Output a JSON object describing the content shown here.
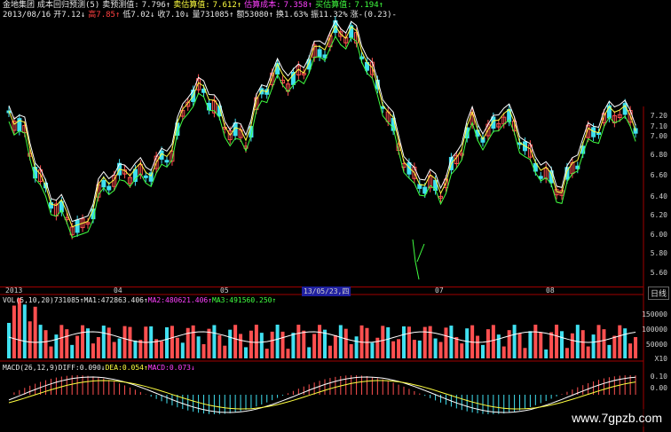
{
  "header": {
    "line1": [
      {
        "text": "金地集团",
        "color": "c-w"
      },
      {
        "text": "成本回归预测(5)",
        "color": "c-w"
      },
      {
        "text": "卖预测值:",
        "color": "c-w"
      },
      {
        "text": "7.796↑",
        "color": "c-w"
      },
      {
        "text": "卖估算值:",
        "color": "c-y"
      },
      {
        "text": "7.612↑",
        "color": "c-y"
      },
      {
        "text": "估算成本:",
        "color": "c-m"
      },
      {
        "text": "7.358↑",
        "color": "c-m"
      },
      {
        "text": "买估算值:",
        "color": "c-g"
      },
      {
        "text": "7.194↑",
        "color": "c-g"
      }
    ],
    "line2": [
      {
        "text": "2013/08/16",
        "color": "c-w"
      },
      {
        "text": "开7.12↓",
        "color": "c-w"
      },
      {
        "text": "高7.85↑",
        "color": "c-r"
      },
      {
        "text": "低7.02↓",
        "color": "c-w"
      },
      {
        "text": "收7.10↓",
        "color": "c-w"
      },
      {
        "text": "量731085↑",
        "color": "c-w"
      },
      {
        "text": "额53080↑",
        "color": "c-w"
      },
      {
        "text": "换1.63%",
        "color": "c-w"
      },
      {
        "text": "振11.32%",
        "color": "c-w"
      },
      {
        "text": "涨-(0.23)-",
        "color": "c-w"
      }
    ]
  },
  "price_axis": [
    "7.20",
    "7.10",
    "7.00",
    "6.80",
    "6.60",
    "6.40",
    "6.20",
    "6.00",
    "5.80",
    "5.60"
  ],
  "date_axis": {
    "labels": [
      "2013",
      "04",
      "05",
      "07",
      "08"
    ],
    "highlight": "13/05/23,四",
    "right_button": "日线"
  },
  "volume": {
    "header": [
      {
        "text": "VOL(5,10,20)",
        "color": "c-w"
      },
      {
        "text": "731085↑",
        "color": "c-w"
      },
      {
        "text": "MA1:472863.406↑",
        "color": "c-w"
      },
      {
        "text": "MA2:480621.406↑",
        "color": "c-m"
      },
      {
        "text": "MA3:491560.250↑",
        "color": "c-g"
      }
    ],
    "axis": [
      "150000",
      "100000",
      "50000",
      "X10"
    ]
  },
  "macd": {
    "header": [
      {
        "text": "MACD(26,12,9)",
        "color": "c-w"
      },
      {
        "text": "DIFF:0.090↓",
        "color": "c-w"
      },
      {
        "text": "DEA:0.054↑",
        "color": "c-y"
      },
      {
        "text": "MACD:0.073↓",
        "color": "c-m"
      }
    ],
    "axis": [
      "0.10",
      "0.00"
    ]
  },
  "watermark": "www.7gpzb.com",
  "colors": {
    "up": "#ff5050",
    "down": "#40e0f0",
    "ma1": "#ffffff",
    "ma2": "#ffff40",
    "ma3": "#40ff40"
  }
}
